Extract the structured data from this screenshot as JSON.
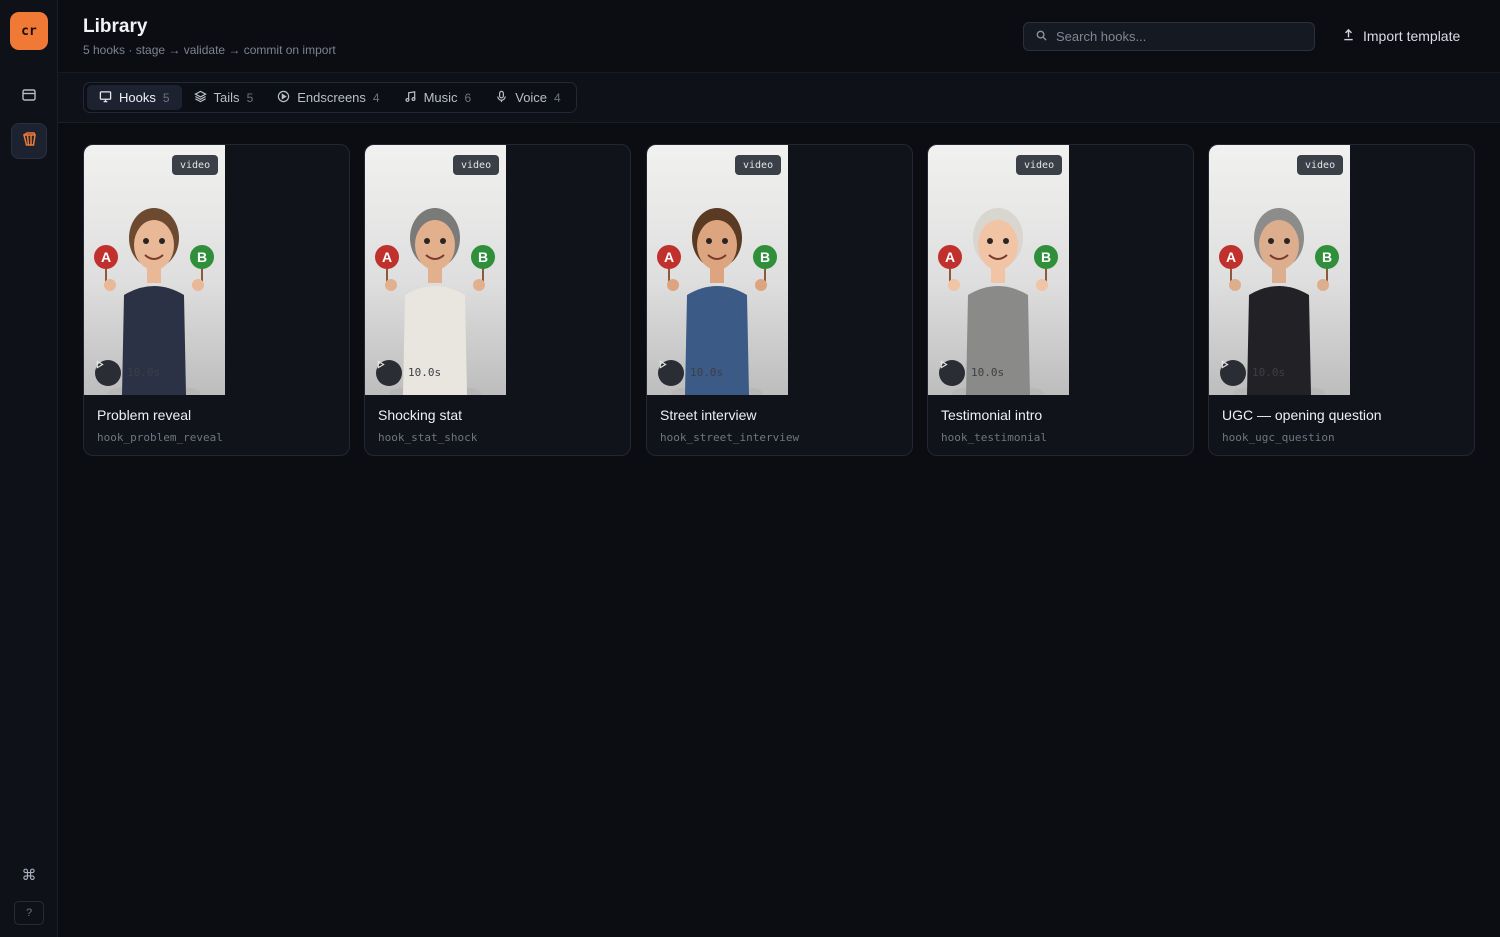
{
  "sidebar": {
    "logo_text": "cr",
    "items": [
      {
        "icon": "inbox-icon"
      },
      {
        "icon": "library-icon",
        "active": true
      }
    ],
    "command_icon": "⌘",
    "help_label": "?"
  },
  "header": {
    "title": "Library",
    "subtitle": "5 hooks · stage → validate → commit on import",
    "search_placeholder": "Search hooks...",
    "import_label": "Import template"
  },
  "tabs": [
    {
      "label": "Hooks",
      "count": "5",
      "icon": "monitor-icon",
      "active": true
    },
    {
      "label": "Tails",
      "count": "5",
      "icon": "layers-icon"
    },
    {
      "label": "Endscreens",
      "count": "4",
      "icon": "play-circle-icon"
    },
    {
      "label": "Music",
      "count": "6",
      "icon": "music-note-icon"
    },
    {
      "label": "Voice",
      "count": "4",
      "icon": "microphone-icon"
    }
  ],
  "cards": [
    {
      "title": "Problem reveal",
      "id": "hook_problem_reveal",
      "badge": "video",
      "duration": "10.0s",
      "outfit": "#2b3246",
      "hair": "#6b4a30",
      "skin": "#e9b896"
    },
    {
      "title": "Shocking stat",
      "id": "hook_stat_shock",
      "badge": "video",
      "duration": "10.0s",
      "outfit": "#e9e6e0",
      "hair": "#7a7a78",
      "skin": "#e3b08e"
    },
    {
      "title": "Street interview",
      "id": "hook_street_interview",
      "badge": "video",
      "duration": "10.0s",
      "outfit": "#3c5a86",
      "hair": "#5a3a22",
      "skin": "#dca57f"
    },
    {
      "title": "Testimonial intro",
      "id": "hook_testimonial",
      "badge": "video",
      "duration": "10.0s",
      "outfit": "#8a8a88",
      "hair": "#d9d6d0",
      "skin": "#f0c4a4"
    },
    {
      "title": "UGC — opening question",
      "id": "hook_ugc_question",
      "badge": "video",
      "duration": "10.0s",
      "outfit": "#222226",
      "hair": "#8c8c8a",
      "skin": "#dcae8e"
    }
  ],
  "colors": {
    "accent": "#f07a35",
    "badge_a": "#c0302c",
    "badge_b": "#2f8f3a"
  }
}
